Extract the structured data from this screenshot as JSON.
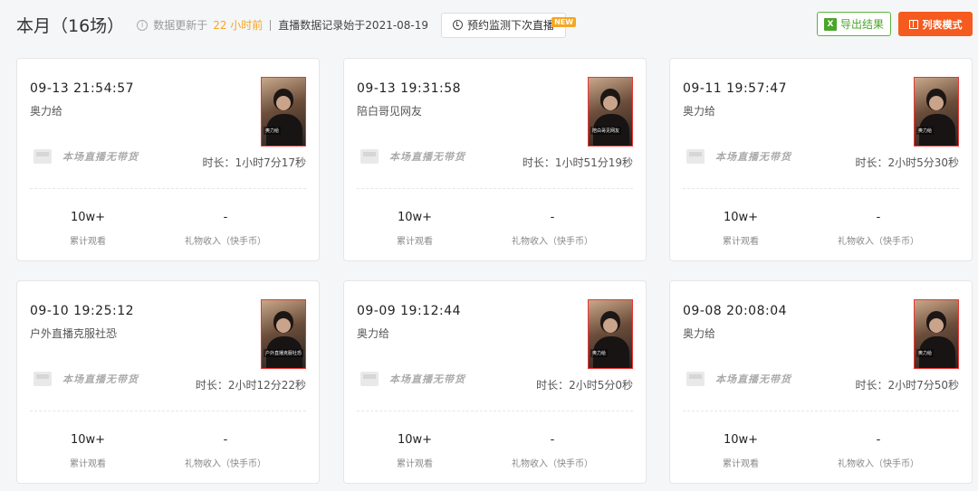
{
  "header": {
    "title": "本月（16场）",
    "update_text": "数据更新于",
    "update_value": "22 小时前",
    "record_text": "直播数据记录始于2021-08-19",
    "monitor_label": "预约监测下次直播",
    "new_badge": "NEW",
    "export_label": "导出结果",
    "list_mode_label": "列表模式"
  },
  "cards": [
    {
      "time": "09-13 21:54:57",
      "name": "奥力给",
      "goods": "本场直播无带货",
      "duration": "时长：1小时7分17秒",
      "viewers": "10w+",
      "viewers_label": "累计观看",
      "gift": "-",
      "gift_label": "礼物收入（快手币）",
      "thumb_caption": "奥力给"
    },
    {
      "time": "09-13 19:31:58",
      "name": "陪白哥见网友",
      "goods": "本场直播无带货",
      "duration": "时长：1小时51分19秒",
      "viewers": "10w+",
      "viewers_label": "累计观看",
      "gift": "-",
      "gift_label": "礼物收入（快手币）",
      "thumb_caption": "陪白哥见网友"
    },
    {
      "time": "09-11 19:57:47",
      "name": "奥力给",
      "goods": "本场直播无带货",
      "duration": "时长：2小时5分30秒",
      "viewers": "10w+",
      "viewers_label": "累计观看",
      "gift": "-",
      "gift_label": "礼物收入（快手币）",
      "thumb_caption": "奥力给"
    },
    {
      "time": "09-10 19:25:12",
      "name": "户外直播克服社恐",
      "goods": "本场直播无带货",
      "duration": "时长：2小时12分22秒",
      "viewers": "10w+",
      "viewers_label": "累计观看",
      "gift": "-",
      "gift_label": "礼物收入（快手币）",
      "thumb_caption": "户外直播克服社恐"
    },
    {
      "time": "09-09 19:12:44",
      "name": "奥力给",
      "goods": "本场直播无带货",
      "duration": "时长：2小时5分0秒",
      "viewers": "10w+",
      "viewers_label": "累计观看",
      "gift": "-",
      "gift_label": "礼物收入（快手币）",
      "thumb_caption": "奥力给"
    },
    {
      "time": "09-08 20:08:04",
      "name": "奥力给",
      "goods": "本场直播无带货",
      "duration": "时长：2小时7分50秒",
      "viewers": "10w+",
      "viewers_label": "累计观看",
      "gift": "-",
      "gift_label": "礼物收入（快手币）",
      "thumb_caption": "奥力给"
    }
  ]
}
